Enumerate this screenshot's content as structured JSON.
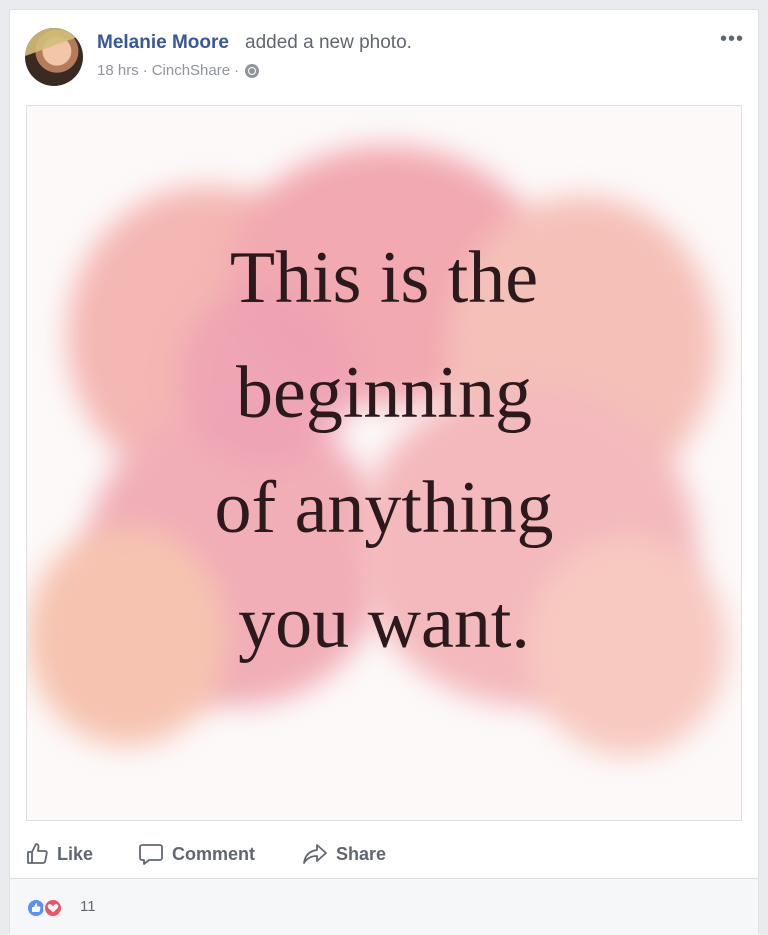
{
  "post": {
    "author": "Melanie Moore",
    "action_text": "added a new photo.",
    "time": "18 hrs",
    "app": "CinchShare",
    "separator": "·",
    "privacy_icon": "globe-icon",
    "more_label": "•••"
  },
  "photo": {
    "quote_lines": [
      "This is the",
      "beginning",
      "of anything",
      "you want."
    ]
  },
  "actions": {
    "like_label": "Like",
    "comment_label": "Comment",
    "share_label": "Share"
  },
  "reactions": {
    "icons": [
      "like-reaction-icon",
      "love-reaction-icon"
    ],
    "count": "11"
  },
  "colors": {
    "link_blue": "#365899",
    "meta_gray": "#90949c",
    "like_blue": "#5890ff",
    "love_red": "#f25268"
  }
}
